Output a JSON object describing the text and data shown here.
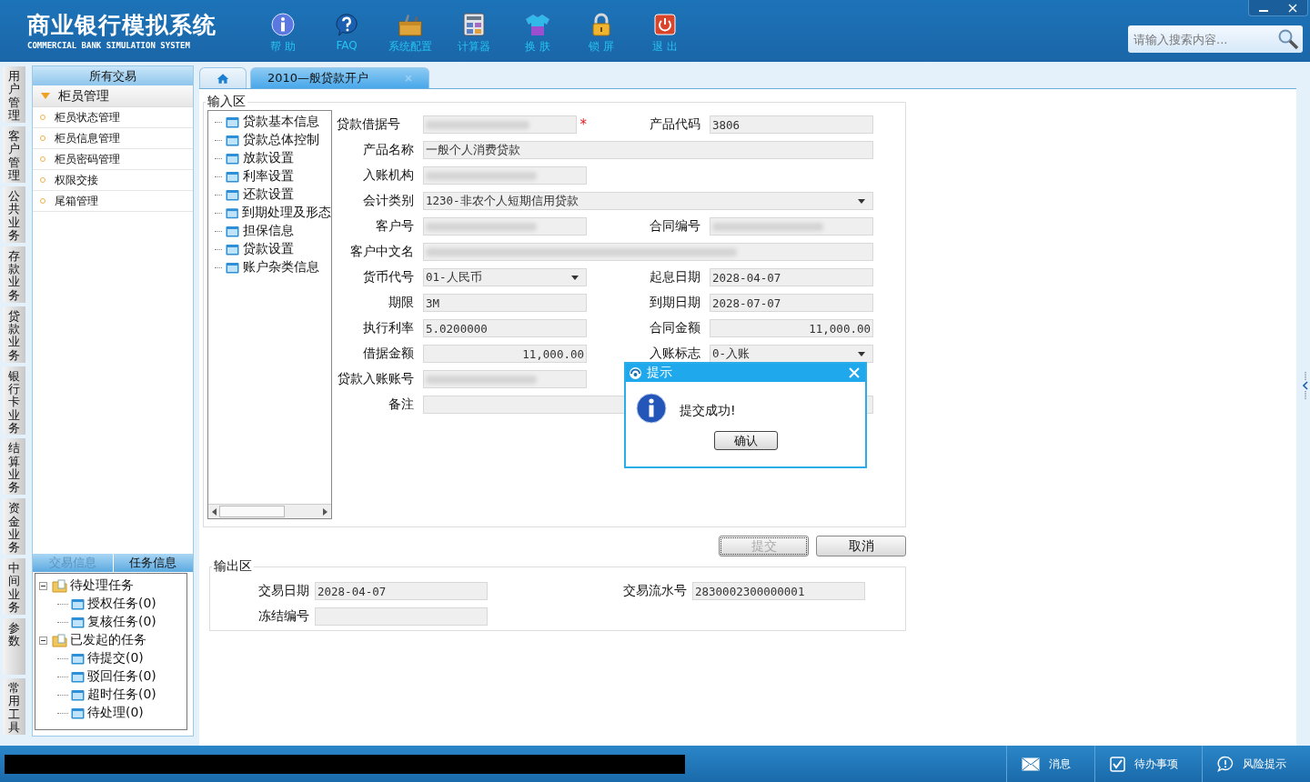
{
  "app": {
    "title": "商业银行模拟系统",
    "subtitle": "COMMERCIAL BANK SIMULATION SYSTEM"
  },
  "toolbar": [
    {
      "label": "帮 助",
      "kind": "info"
    },
    {
      "label": "FAQ",
      "kind": "question"
    },
    {
      "label": "系统配置",
      "kind": "toolbox"
    },
    {
      "label": "计算器",
      "kind": "calculator"
    },
    {
      "label": "换 肤",
      "kind": "shirt"
    },
    {
      "label": "锁 屏",
      "kind": "lock"
    },
    {
      "label": "退 出",
      "kind": "power"
    }
  ],
  "search": {
    "placeholder": "请输入搜索内容..."
  },
  "module_tabs": [
    "用户管理",
    "客户管理",
    "公共业务",
    "存款业务",
    "贷款业务",
    "银行卡业务",
    "结算业务",
    "资金业务",
    "中间业务",
    "参数",
    "常用工具"
  ],
  "sidebar": {
    "header": "所有交易",
    "group": {
      "label": "柜员管理",
      "expanded": true
    },
    "items": [
      "柜员状态管理",
      "柜员信息管理",
      "柜员密码管理",
      "权限交接",
      "尾箱管理"
    ]
  },
  "info_tabs": [
    {
      "label": "交易信息",
      "selected": false
    },
    {
      "label": "任务信息",
      "selected": true
    }
  ],
  "task_tree": [
    {
      "label": "待处理任务",
      "expanded": true,
      "children": [
        {
          "label": "授权任务(0)"
        },
        {
          "label": "复核任务(0)"
        }
      ]
    },
    {
      "label": "已发起的任务",
      "expanded": true,
      "children": [
        {
          "label": "待提交(0)"
        },
        {
          "label": "驳回任务(0)"
        },
        {
          "label": "超时任务(0)"
        },
        {
          "label": "待处理(0)"
        }
      ]
    }
  ],
  "doc_tabs": [
    {
      "kind": "home",
      "selected": false
    },
    {
      "kind": "page",
      "label": "2010—般贷款开户",
      "selected": true
    }
  ],
  "input_area": {
    "title": "输入区",
    "nav_tree": [
      "贷款基本信息",
      "贷款总体控制",
      "放款设置",
      "利率设置",
      "还款设置",
      "到期处理及形态",
      "担保信息",
      "贷款设置",
      "账户杂类信息"
    ],
    "rows": [
      [
        {
          "label": "贷款借据号",
          "kind": "text",
          "blurred": true,
          "required_mark": "*"
        },
        {
          "label": "产品代码",
          "kind": "text",
          "value": "3806"
        }
      ],
      [
        {
          "label": "产品名称",
          "kind": "text",
          "wide": true,
          "value": "一般个人消费贷款"
        }
      ],
      [
        {
          "label": "入账机构",
          "kind": "text",
          "blurred": true
        }
      ],
      [
        {
          "label": "会计类别",
          "kind": "select",
          "wide": true,
          "value": "1230-非农个人短期信用贷款"
        }
      ],
      [
        {
          "label": "客户号",
          "kind": "text",
          "blurred": true
        },
        {
          "label": "合同编号",
          "kind": "text",
          "blurred": true
        }
      ],
      [
        {
          "label": "客户中文名",
          "kind": "text",
          "wide": true,
          "blurred": true
        }
      ],
      [
        {
          "label": "货币代号",
          "kind": "select",
          "value": "01-人民币"
        },
        {
          "label": "起息日期",
          "kind": "text",
          "value": "2028-04-07"
        }
      ],
      [
        {
          "label": "期限",
          "kind": "text",
          "value": "3M"
        },
        {
          "label": "到期日期",
          "kind": "text",
          "value": "2028-07-07"
        }
      ],
      [
        {
          "label": "执行利率",
          "kind": "text",
          "value": "5.0200000"
        },
        {
          "label": "合同金额",
          "kind": "amount",
          "value": "11,000.00"
        }
      ],
      [
        {
          "label": "借据金额",
          "kind": "amount",
          "value": "11,000.00"
        },
        {
          "label": "入账标志",
          "kind": "select",
          "value": "0-入账"
        }
      ],
      [
        {
          "label": "贷款入账账号",
          "kind": "text",
          "blurred": true
        }
      ],
      [
        {
          "label": "备注",
          "kind": "text",
          "wide": true
        }
      ]
    ]
  },
  "actions": [
    {
      "label": "提交",
      "disabled": true
    },
    {
      "label": "取消",
      "disabled": false
    }
  ],
  "output_area": {
    "title": "输出区",
    "rows": [
      [
        {
          "label": "交易日期",
          "value": "2028-04-07"
        },
        {
          "label": "交易流水号",
          "value": "2830002300000001"
        }
      ],
      [
        {
          "label": "冻结编号"
        }
      ]
    ]
  },
  "dialog": {
    "title": "提示",
    "message": "提交成功!",
    "button": "确认"
  },
  "status_bar": [
    {
      "label": "消息",
      "kind": "mail"
    },
    {
      "label": "待办事项",
      "kind": "check"
    },
    {
      "label": "风险提示",
      "kind": "speech"
    }
  ]
}
